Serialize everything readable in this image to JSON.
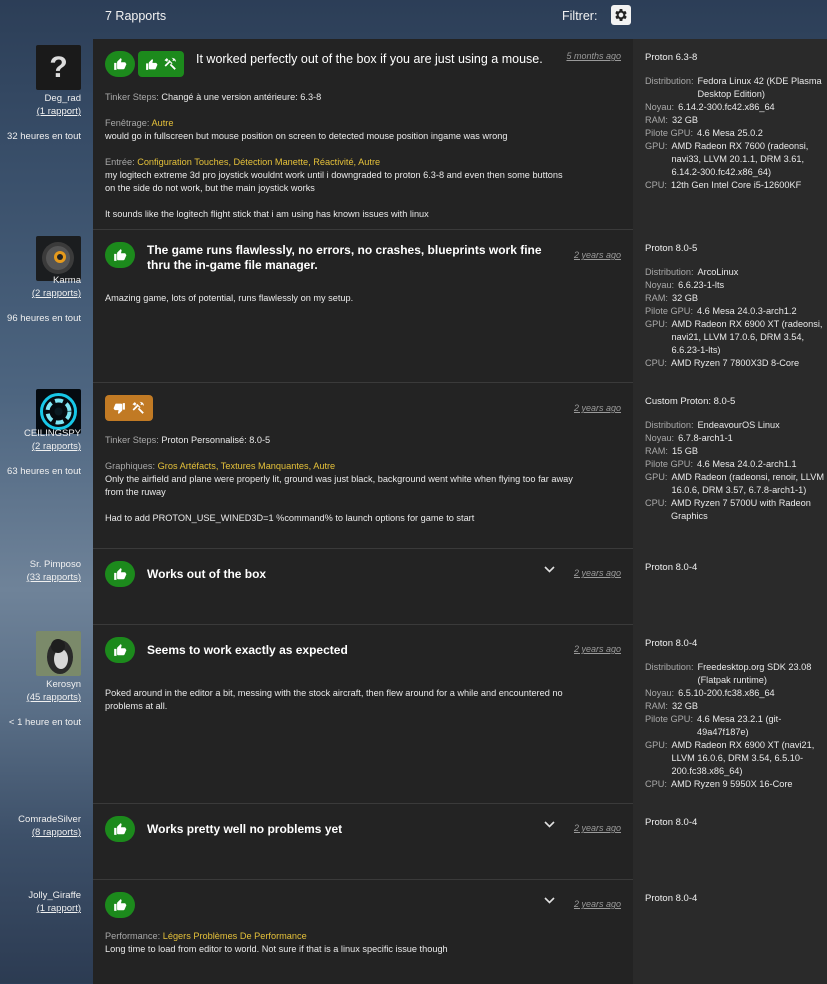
{
  "header": {
    "count": "7 Rapports",
    "filter_label": "Filtrer:",
    "filter_icon": "gear-icon"
  },
  "reports": [
    {
      "user": {
        "name": "Deg_rad",
        "reports": "(1 rapport)",
        "playtime": "32 heures en tout",
        "avatar": "question-mark-avatar"
      },
      "verdict": "Works",
      "title": "It worked perfectly out of the box if you are just using a mouse.",
      "date": "5 months ago",
      "tinker": {
        "label": "Tinker Steps:",
        "value": "Changé à une version antérieure: 6.3-8"
      },
      "sections": [
        {
          "label": "Fenêtrage:",
          "tags": "Autre",
          "text": "would go in fullscreen but mouse position on screen to detected mouse position ingame was wrong"
        },
        {
          "label": "Entrée:",
          "tags": "Configuration Touches, Détection Manette, Réactivité, Autre",
          "text": "my logitech extreme 3d pro joystick wouldnt work until i downgraded to proton 6.3-8 and even then some buttons on the side do not work, but the main joystick works"
        }
      ],
      "note": "It sounds like the logitech flight stick that i am using has known issues with linux",
      "system": {
        "proton": "Proton 6.3-8",
        "distribution": "Fedora Linux 42 (KDE Plasma Desktop Edition)",
        "noyau": "6.14.2-300.fc42.x86_64",
        "ram": "32 GB",
        "pilote": "4.6 Mesa 25.0.2",
        "gpu": "AMD Radeon RX 7600 (radeonsi, navi33, LLVM 20.1.1, DRM 3.61, 6.14.2-300.fc42.x86_64)",
        "cpu": "12th Gen Intel Core i5-12600KF"
      }
    },
    {
      "user": {
        "name": "Karma",
        "reports": "(2 rapports)",
        "playtime": "96 heures en tout",
        "avatar": "robot-avatar"
      },
      "title": "The game runs flawlessly, no errors, no crashes, blueprints work fine thru the in-game file manager.",
      "date": "2 years ago",
      "note": "Amazing game, lots of potential, runs flawlessly on my setup.",
      "system": {
        "proton": "Proton 8.0-5",
        "distribution": "ArcoLinux",
        "noyau": "6.6.23-1-lts",
        "ram": "32 GB",
        "pilote": "4.6 Mesa 24.0.3-arch1.2",
        "gpu": "AMD Radeon RX 6900 XT (radeonsi, navi21, LLVM 17.0.6, DRM 3.54, 6.6.23-1-lts)",
        "cpu": "AMD Ryzen 7 7800X3D 8-Core"
      }
    },
    {
      "user": {
        "name": "CEILINGSPY",
        "reports": "(2 rapports)",
        "playtime": "63 heures en tout",
        "avatar": "portal-avatar"
      },
      "date": "2 years ago",
      "tinker": {
        "label": "Tinker Steps:",
        "value": "Proton Personnalisé: 8.0-5"
      },
      "sections": [
        {
          "label": "Graphiques:",
          "tags": "Gros Artéfacts, Textures Manquantes, Autre",
          "text": "Only the airfield and plane were properly lit, ground was just black, background went white when flying too far away from the ruway"
        }
      ],
      "note": "Had to add PROTON_USE_WINED3D=1 %command% to launch options for game to start",
      "system": {
        "proton": "Custom Proton: 8.0-5",
        "distribution": "EndeavourOS Linux",
        "noyau": "6.7.8-arch1-1",
        "ram": "15 GB",
        "pilote": "4.6 Mesa 24.0.2-arch1.1",
        "gpu": "AMD Radeon (radeonsi, renoir, LLVM 16.0.6, DRM 3.57, 6.7.8-arch1-1)",
        "cpu": "AMD Ryzen 7 5700U with Radeon Graphics"
      }
    },
    {
      "user": {
        "name": "Sr. Pimposo",
        "reports": "(33 rapports)"
      },
      "title": "Works out of the box",
      "date": "2 years ago",
      "system": {
        "proton": "Proton 8.0-4"
      }
    },
    {
      "user": {
        "name": "Kerosyn",
        "reports": "(45 rapports)",
        "playtime": "< 1 heure en tout",
        "avatar": "penguin-avatar"
      },
      "title": "Seems to work exactly as expected",
      "date": "2 years ago",
      "note": "Poked around in the editor a bit, messing with the stock aircraft, then flew around for a while and encountered no problems at all.",
      "system": {
        "proton": "Proton 8.0-4",
        "distribution": "Freedesktop.org SDK 23.08 (Flatpak runtime)",
        "noyau": "6.5.10-200.fc38.x86_64",
        "ram": "32 GB",
        "pilote": "4.6 Mesa 23.2.1 (git-49a47f187e)",
        "gpu": "AMD Radeon RX 6900 XT (navi21, LLVM 16.0.6, DRM 3.54, 6.5.10-200.fc38.x86_64)",
        "cpu": "AMD Ryzen 9 5950X 16-Core"
      }
    },
    {
      "user": {
        "name": "ComradeSilver",
        "reports": "(8 rapports)"
      },
      "title": "Works pretty well no problems yet",
      "date": "2 years ago",
      "system": {
        "proton": "Proton 8.0-4"
      }
    },
    {
      "user": {
        "name": "Jolly_Giraffe",
        "reports": "(1 rapport)"
      },
      "date": "2 years ago",
      "sections": [
        {
          "label": "Performance:",
          "tags": "Légers Problèmes De Performance",
          "text": "Long time to load from editor to world. Not sure if that is a linux specific issue though"
        }
      ],
      "system": {
        "proton": "Proton 8.0-4"
      }
    }
  ],
  "labels": {
    "distribution": "Distribution:",
    "noyau": "Noyau:",
    "ram": "RAM:",
    "pilote": "Pilote GPU:",
    "gpu": "GPU:",
    "cpu": "CPU:"
  },
  "colors": {
    "works": "#1c8a1c",
    "tinker_broken": "#c17a24",
    "tag": "#e5c13a",
    "card": "#232323",
    "sidebar": "#2a2a2a"
  }
}
